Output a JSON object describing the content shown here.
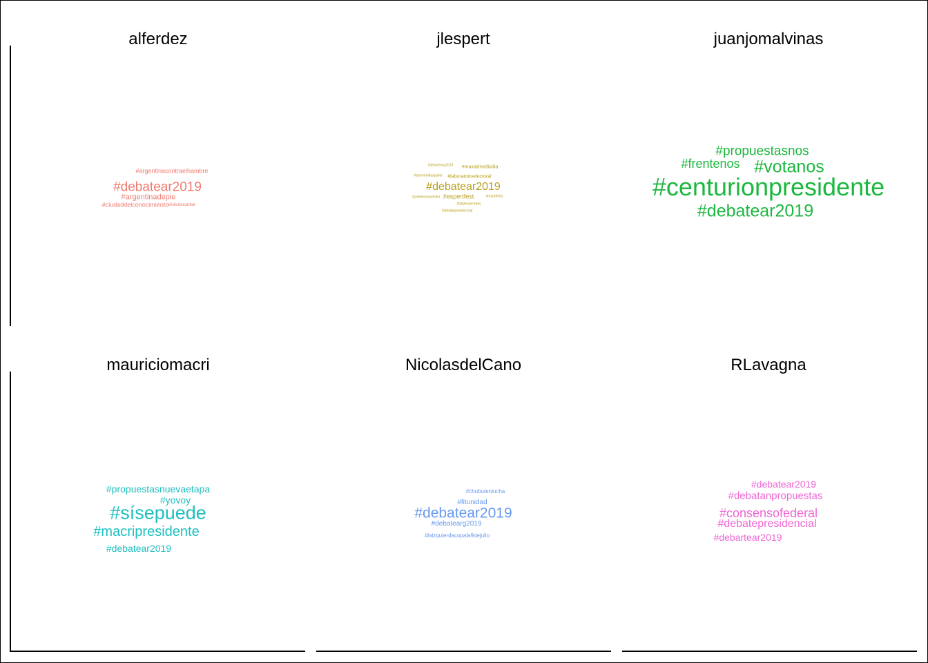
{
  "panels": [
    {
      "title": "alferdez",
      "color": "#F07A70",
      "words": [
        "#argentinacontraelhambre",
        "#debatear2019",
        "#argentinadepie",
        "#ciudaddelconocimiento",
        "#lideobucarbal"
      ]
    },
    {
      "title": "jlespert",
      "color": "#B8A11A",
      "words": [
        "#debatearg2019",
        "#maxialmediodia",
        "#bienvenidasjuoler",
        "#laboratorioelectoral",
        "#debatear2019",
        "#yoleinicioavestlur",
        "#espertfest",
        "#tiradefetry",
        "#tiduleruncedes",
        "#debatepresidencial"
      ]
    },
    {
      "title": "juanjomalvinas",
      "color": "#1CB73F",
      "words": [
        "#propuestasnos",
        "#frentenos",
        "#votanos",
        "#centurionpresidente",
        "#debatear2019"
      ]
    },
    {
      "title": "mauriciomacri",
      "color": "#1FBFBF",
      "words": [
        "#propuestasnuevaetapa",
        "#yovoy",
        "#sísepuede",
        "#macripresidente",
        "#debatear2019"
      ]
    },
    {
      "title": "NicolasdelCano",
      "color": "#6699EE",
      "words": [
        "#chubutenlucha",
        "#fitunidad",
        "#debatear2019",
        "#debatearg2019",
        "#laizquierdacopala9dejulio"
      ]
    },
    {
      "title": "RLavagna",
      "color": "#EE66D4",
      "words": [
        "#debatear2019",
        "#debatanpropuestas",
        "#consensofederal",
        "#debatepresidencial",
        "#debartear2019"
      ]
    }
  ],
  "chart_data": {
    "type": "wordcloud",
    "facets": [
      {
        "name": "alferdez",
        "terms": [
          {
            "text": "#debatear2019",
            "rank": 1
          },
          {
            "text": "#argentinadepie",
            "rank": 2
          },
          {
            "text": "#argentinacontraelhambre",
            "rank": 3
          },
          {
            "text": "#ciudaddelconocimiento",
            "rank": 3
          },
          {
            "text": "#lideobucarbal",
            "rank": 4
          }
        ]
      },
      {
        "name": "jlespert",
        "terms": [
          {
            "text": "#debatear2019",
            "rank": 1
          },
          {
            "text": "#espertfest",
            "rank": 2
          },
          {
            "text": "#laboratorioelectoral",
            "rank": 3
          },
          {
            "text": "#maxialmediodia",
            "rank": 3
          },
          {
            "text": "#debatepresidencial",
            "rank": 4
          },
          {
            "text": "#debatearg2019",
            "rank": 4
          },
          {
            "text": "#bienvenidasjuoler",
            "rank": 4
          },
          {
            "text": "#yoleinicioavestlur",
            "rank": 4
          },
          {
            "text": "#tiradefetry",
            "rank": 4
          },
          {
            "text": "#tiduleruncedes",
            "rank": 4
          }
        ]
      },
      {
        "name": "juanjomalvinas",
        "terms": [
          {
            "text": "#centurionpresidente",
            "rank": 1
          },
          {
            "text": "#votanos",
            "rank": 2
          },
          {
            "text": "#debatear2019",
            "rank": 2
          },
          {
            "text": "#propuestasnos",
            "rank": 3
          },
          {
            "text": "#frentenos",
            "rank": 3
          }
        ]
      },
      {
        "name": "mauriciomacri",
        "terms": [
          {
            "text": "#sísepuede",
            "rank": 1
          },
          {
            "text": "#macripresidente",
            "rank": 2
          },
          {
            "text": "#propuestasnuevaetapa",
            "rank": 3
          },
          {
            "text": "#yovoy",
            "rank": 3
          },
          {
            "text": "#debatear2019",
            "rank": 3
          }
        ]
      },
      {
        "name": "NicolasdelCano",
        "terms": [
          {
            "text": "#debatear2019",
            "rank": 1
          },
          {
            "text": "#fitunidad",
            "rank": 2
          },
          {
            "text": "#debatearg2019",
            "rank": 2
          },
          {
            "text": "#chubutenlucha",
            "rank": 3
          },
          {
            "text": "#laizquierdacopala9dejulio",
            "rank": 3
          }
        ]
      },
      {
        "name": "RLavagna",
        "terms": [
          {
            "text": "#consensofederal",
            "rank": 1
          },
          {
            "text": "#debatepresidencial",
            "rank": 1
          },
          {
            "text": "#debatanpropuestas",
            "rank": 2
          },
          {
            "text": "#debatear2019",
            "rank": 2
          },
          {
            "text": "#debartear2019",
            "rank": 2
          }
        ]
      }
    ]
  }
}
